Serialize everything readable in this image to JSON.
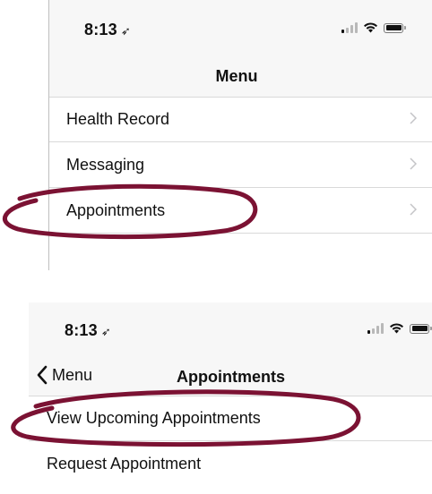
{
  "screen1": {
    "status": {
      "time": "8:13",
      "location_arrow": "➶"
    },
    "nav": {
      "title": "Menu"
    },
    "items": [
      {
        "label": "Health Record"
      },
      {
        "label": "Messaging"
      },
      {
        "label": "Appointments"
      }
    ]
  },
  "screen2": {
    "status": {
      "time": "8:13",
      "location_arrow": "➶"
    },
    "nav": {
      "back_label": "Menu",
      "title": "Appointments"
    },
    "items": [
      {
        "label": "View Upcoming Appointments"
      },
      {
        "label": "Request Appointment"
      }
    ]
  },
  "colors": {
    "highlight": "#7b1233",
    "bar_bg": "#f7f7f7",
    "separator": "#d9d9d9"
  },
  "icons": [
    "location-arrow-icon",
    "signal-icon",
    "wifi-icon",
    "battery-icon",
    "chevron-right-icon",
    "back-chevron-icon"
  ]
}
